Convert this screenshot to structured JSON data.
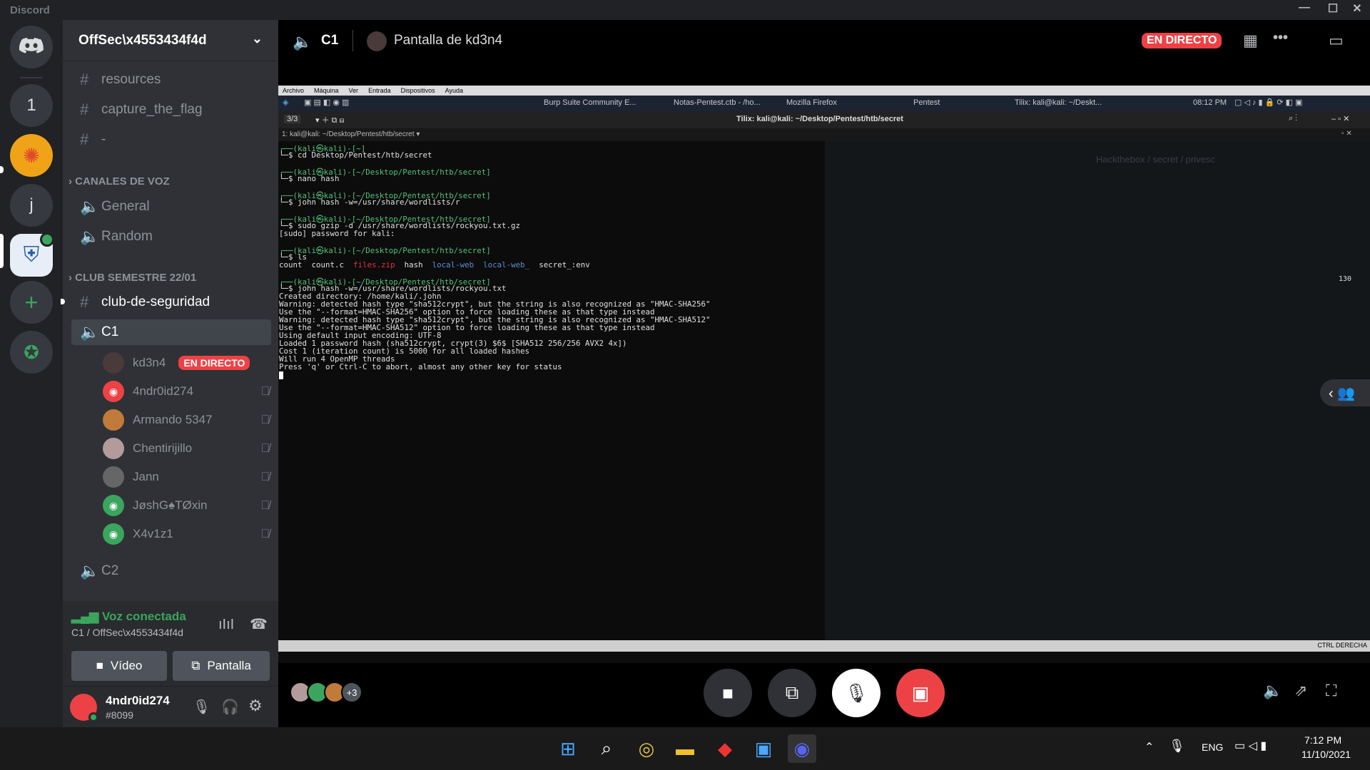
{
  "window": {
    "app_name": "Discord",
    "minimize": "—",
    "maximize": "☐",
    "close": "✕"
  },
  "guilds": [
    {
      "label": "1"
    },
    {
      "label": "j"
    }
  ],
  "server": {
    "name": "OffSec\\x4553434f4d"
  },
  "channels": {
    "text": [
      {
        "label": "resources"
      },
      {
        "label": "capture_the_flag"
      },
      {
        "label": "-"
      }
    ],
    "voice_category": "CANALES DE VOZ",
    "voice": [
      {
        "label": "General"
      },
      {
        "label": "Random"
      }
    ],
    "club_category": "CLUB SEMESTRE 22/01",
    "club_text": "club-de-seguridad",
    "active_voice": "C1",
    "voice_users": [
      {
        "name": "kd3n4",
        "badge": "EN DIRECTO",
        "color": "#4a3a3a"
      },
      {
        "name": "4ndr0id274",
        "color": "#ed4245"
      },
      {
        "name": "Armando 5347",
        "color": "#c07a3a"
      },
      {
        "name": "Chentirijillo",
        "color": "#b39b9b"
      },
      {
        "name": "Jann",
        "color": "#666"
      },
      {
        "name": "JøshG♠TØxin",
        "color": "#3ba55d"
      },
      {
        "name": "X4v1z1",
        "color": "#3ba55d"
      }
    ],
    "other_voice": "C2"
  },
  "voice_panel": {
    "status": "Voz conectada",
    "location": "C1 / OffSec\\x4553434f4d",
    "video_btn": "Vídeo",
    "screen_btn": "Pantalla"
  },
  "user_panel": {
    "name": "4ndr0id274",
    "tag": "#8099"
  },
  "stream_header": {
    "channel": "C1",
    "title": "Pantalla de kd3n4",
    "live": "EN DIRECTO",
    "more": "•••"
  },
  "vm": {
    "menu": [
      "Archivo",
      "Máquina",
      "Ver",
      "Entrada",
      "Dispositivos",
      "Ayuda"
    ],
    "tasks": [
      "Burp Suite Community E...",
      "Notas-Pentest.ctb - /ho...",
      "Mozilla Firefox",
      "Pentest",
      "Tilix: kali@kali: ~/Deskt..."
    ],
    "time": "08:12 PM",
    "tilix_counter": "3/3",
    "tilix_title": "Tilix: kali@kali: ~/Desktop/Pentest/htb/secret",
    "tab_title": "1: kali@kali: ~/Desktop/Pentest/htb/secret",
    "right_number": "130",
    "bottom_right": "CTRL DERECHA",
    "bg_breadcrumb": "Hackthebox / secret / privesc"
  },
  "terminal": {
    "p1": "┌──(kali㉿kali)-[~]",
    "c1": "└─$ cd Desktop/Pentest/htb/secret",
    "p2": "┌──(kali㉿kali)-[~/Desktop/Pentest/htb/secret]",
    "c2": "└─$ nano hash",
    "p3": "┌──(kali㉿kali)-[~/Desktop/Pentest/htb/secret]",
    "c3": "└─$ john hash -w=/usr/share/wordlists/r",
    "p4": "┌──(kali㉿kali)-[~/Desktop/Pentest/htb/secret]",
    "c4": "└─$ sudo gzip -d /usr/share/wordlists/rockyou.txt.gz",
    "o4": "[sudo] password for kali:",
    "p5": "┌──(kali㉿kali)-[~/Desktop/Pentest/htb/secret]",
    "c5": "└─$ ls",
    "ls": [
      "count",
      "count.c",
      "files.zip",
      "hash",
      "local-web",
      "local-web_",
      "secret_:env"
    ],
    "p6": "┌──(kali㉿kali)-[~/Desktop/Pentest/htb/secret]",
    "c6": "└─$ john hash -w=/usr/share/wordlists/rockyou.txt",
    "out": [
      "Created directory: /home/kali/.john",
      "Warning: detected hash type \"sha512crypt\", but the string is also recognized as \"HMAC-SHA256\"",
      "Use the \"--format=HMAC-SHA256\" option to force loading these as that type instead",
      "Warning: detected hash type \"sha512crypt\", but the string is also recognized as \"HMAC-SHA512\"",
      "Use the \"--format=HMAC-SHA512\" option to force loading these as that type instead",
      "Using default input encoding: UTF-8",
      "Loaded 1 password hash (sha512crypt, crypt(3) $6$ [SHA512 256/256 AVX2 4x])",
      "Cost 1 (iteration count) is 5000 for all loaded hashes",
      "Will run 4 OpenMP threads",
      "Press 'q' or Ctrl-C to abort, almost any other key for status"
    ]
  },
  "controls": {
    "viewers_extra": "+3"
  },
  "win_taskbar": {
    "lang": "ENG",
    "time": "7:12 PM",
    "date": "11/10/2021"
  },
  "colors": {
    "live_red": "#ed4245",
    "online_green": "#3ba55d",
    "discord_blurple": "#5865f2"
  }
}
